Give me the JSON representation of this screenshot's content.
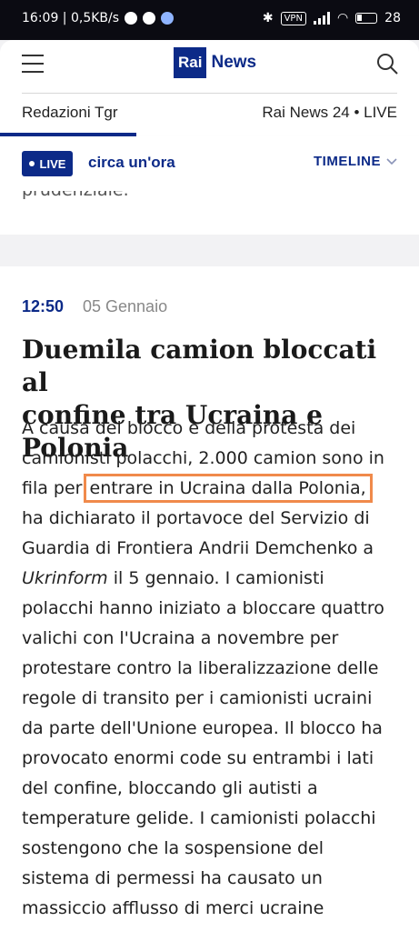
{
  "statusbar": {
    "time_speed": "16:09 | 0,5KB/s",
    "vpn": "VPN",
    "battery": "28"
  },
  "header": {
    "logo_rai": "Rai",
    "logo_news": "News",
    "nav_left": "Redazioni Tgr",
    "nav_right": "Rai News 24 • LIVE"
  },
  "live_bar": {
    "badge": "LIVE",
    "time_ago": "circa un'ora",
    "timeline": "TIMELINE"
  },
  "previous": {
    "text": "prudenziale."
  },
  "article": {
    "time": "12:50",
    "date": "05 Gennaio",
    "title_line1": "Duemila camion bloccati al",
    "title_line2": "confine tra Ucraina e Polonia",
    "lines": [
      "A causa del blocco e della protesta dei",
      "camionisti polacchi, 2.000 camion sono in",
      "fila per ",
      "entrare in Ucraina dalla Polonia,",
      "ha dichiarato il portavoce del Servizio di",
      "Guardia di Frontiera Andrii Demchenko a",
      "Ukrinform",
      " il 5 gennaio. I camionisti",
      "polacchi hanno iniziato a bloccare quattro",
      "valichi con l'Ucraina a novembre per",
      "protestare contro la liberalizzazione delle",
      "regole di transito per i camionisti ucraini",
      "da parte dell'Unione europea. Il blocco ha",
      "provocato enormi code su entrambi i lati",
      "del confine, bloccando gli autisti a",
      "temperature gelide. I camionisti polacchi",
      "sostengono che la sospensione del",
      "sistema di permessi ha causato un",
      "massiccio afflusso di merci ucraine"
    ]
  },
  "colors": {
    "brand_blue": "#0c2a88",
    "highlight": "#f08a4b"
  }
}
